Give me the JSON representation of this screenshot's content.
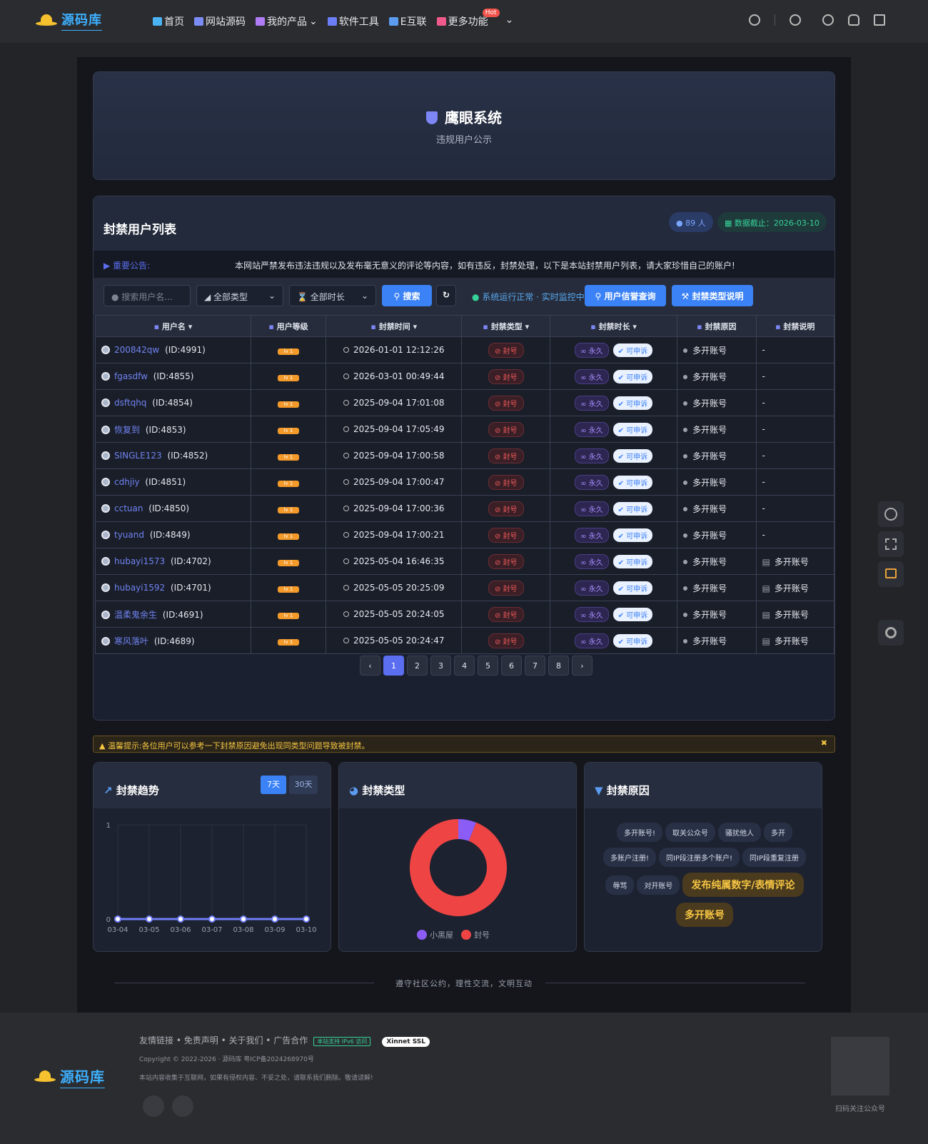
{
  "site": {
    "logo_text": "源码库"
  },
  "nav": [
    {
      "label": "首页",
      "color": "#4ab3f4"
    },
    {
      "label": "网站源码",
      "color": "#7c8cf6"
    },
    {
      "label": "我的产品",
      "color": "#b07cf6"
    },
    {
      "label": "软件工具",
      "color": "#6c7ef6"
    },
    {
      "label": "E互联",
      "color": "#5b9cf0"
    },
    {
      "label": "更多功能",
      "color": "#f05a8a"
    }
  ],
  "nav_badge": "Hot",
  "hero": {
    "title": "鹰眼系统",
    "subtitle": "违规用户公示"
  },
  "list": {
    "title": "封禁用户列表",
    "count": "89 人",
    "date": "数据截止：2026-03-10",
    "notice_label": "重要公告:",
    "notice": "本网站严禁发布违法违规以及发布毫无意义的评论等内容，如有违反，封禁处理，以下是本站封禁用户列表，请大家珍惜自己的账户!",
    "search_placeholder": "搜索用户名...",
    "type_select": "全部类型",
    "duration_select": "全部时长",
    "search_button": "搜索",
    "status": "系统运行正常 · 实时监控中",
    "credit_button": "用户信誉查询",
    "type_button": "封禁类型说明",
    "columns": [
      "用户名",
      "用户等级",
      "封禁时间",
      "封禁类型",
      "封禁时长",
      "封禁原因",
      "封禁说明"
    ],
    "rows": [
      {
        "name": "200842qw",
        "id": "(ID:4991)",
        "time": "2026-01-01 12:12:26",
        "reason": "多开账号",
        "desc": "-"
      },
      {
        "name": "fgasdfw",
        "id": "(ID:4855)",
        "time": "2026-03-01 00:49:44",
        "reason": "多开账号",
        "desc": "-"
      },
      {
        "name": "dsftqhq",
        "id": "(ID:4854)",
        "time": "2025-09-04 17:01:08",
        "reason": "多开账号",
        "desc": "-"
      },
      {
        "name": "恢复到",
        "id": "(ID:4853)",
        "time": "2025-09-04 17:05:49",
        "reason": "多开账号",
        "desc": "-"
      },
      {
        "name": "SINGLE123",
        "id": "(ID:4852)",
        "time": "2025-09-04 17:00:58",
        "reason": "多开账号",
        "desc": "-"
      },
      {
        "name": "cdhjiy",
        "id": "(ID:4851)",
        "time": "2025-09-04 17:00:47",
        "reason": "多开账号",
        "desc": "-"
      },
      {
        "name": "cctuan",
        "id": "(ID:4850)",
        "time": "2025-09-04 17:00:36",
        "reason": "多开账号",
        "desc": "-"
      },
      {
        "name": "tyuand",
        "id": "(ID:4849)",
        "time": "2025-09-04 17:00:21",
        "reason": "多开账号",
        "desc": "-"
      },
      {
        "name": "hubayi1573",
        "id": "(ID:4702)",
        "time": "2025-05-04 16:46:35",
        "reason": "多开账号",
        "desc": "多开账号"
      },
      {
        "name": "hubayi1592",
        "id": "(ID:4701)",
        "time": "2025-05-05 20:25:09",
        "reason": "多开账号",
        "desc": "多开账号"
      },
      {
        "name": "温柔鬼余生",
        "id": "(ID:4691)",
        "time": "2025-05-05 20:24:05",
        "reason": "多开账号",
        "desc": "多开账号"
      },
      {
        "name": "寒风落叶",
        "id": "(ID:4689)",
        "time": "2025-05-05 20:24:47",
        "reason": "多开账号",
        "desc": "多开账号"
      }
    ],
    "level_label": "lv 1",
    "ban_type": "封号",
    "ban_perm": "永久",
    "appeal": "可申诉",
    "pages": [
      "1",
      "2",
      "3",
      "4",
      "5",
      "6",
      "7",
      "8"
    ]
  },
  "warning": "温馨提示:各位用户可以参考一下封禁原因避免出现同类型问题导致被封禁。",
  "trend": {
    "title": "封禁趋势",
    "tab7": "7天",
    "tab30": "30天"
  },
  "types": {
    "title": "封禁类型"
  },
  "reasons": {
    "title": "封禁原因",
    "tags": [
      "多开账号!",
      "取关公众号",
      "骚扰他人",
      "多开",
      "多账户注册!",
      "同IP段注册多个账户!",
      "同IP段重复注册",
      "辱骂",
      "对开账号"
    ],
    "big_tags": [
      "发布纯属数字/表情评论",
      "多开账号"
    ]
  },
  "chart_data": [
    {
      "type": "line",
      "title": "封禁趋势",
      "categories": [
        "03-04",
        "03-05",
        "03-06",
        "03-07",
        "03-08",
        "03-09",
        "03-10"
      ],
      "series": [
        {
          "values": [
            0,
            0,
            0,
            0,
            0,
            0,
            0
          ]
        }
      ],
      "ylim": [
        0,
        1
      ],
      "yticks": [
        "0",
        "1"
      ]
    },
    {
      "type": "pie",
      "title": "封禁类型",
      "slices": [
        {
          "name": "小黑屋",
          "value": 6,
          "color": "#8b5cf6"
        },
        {
          "name": "封号",
          "value": 94,
          "color": "#ef4444"
        }
      ]
    }
  ],
  "motto": "遵守社区公约，理性交流，文明互动",
  "footer": {
    "links": [
      "友情链接",
      "免责声明",
      "关于我们",
      "广告合作"
    ],
    "ipv6": "本站支持 IPv6 访问",
    "ssl": "Xinnet SSL",
    "copyright": "Copyright © 2022-2026 · 源码库 粤ICP备2024268970号",
    "desc": "本站内容收集于互联网，如果有侵权内容、不妥之处，请联系我们删除。敬请谅解!",
    "qr_label": "扫码关注公众号"
  }
}
